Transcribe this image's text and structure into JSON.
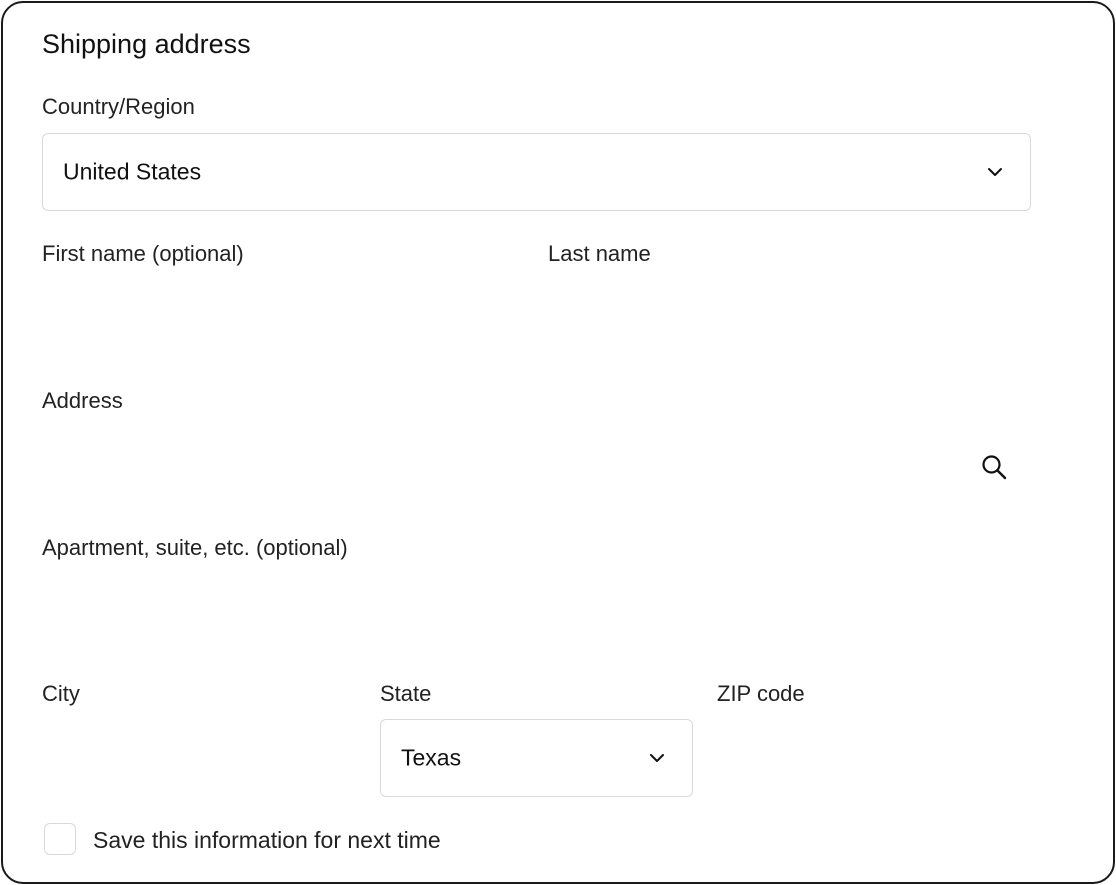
{
  "form": {
    "title": "Shipping address",
    "country": {
      "label": "Country/Region",
      "value": "United States",
      "icon": "chevron-down-icon"
    },
    "first_name": {
      "label": "First name (optional)",
      "value": ""
    },
    "last_name": {
      "label": "Last name",
      "value": ""
    },
    "address": {
      "label": "Address",
      "value": "",
      "icon": "search-icon"
    },
    "apartment": {
      "label": "Apartment, suite, etc. (optional)",
      "value": ""
    },
    "city": {
      "label": "City",
      "value": ""
    },
    "state": {
      "label": "State",
      "value": "Texas",
      "icon": "chevron-down-icon"
    },
    "zip": {
      "label": "ZIP code",
      "value": ""
    },
    "save_info": {
      "label": "Save this information for next time",
      "checked": false
    }
  }
}
